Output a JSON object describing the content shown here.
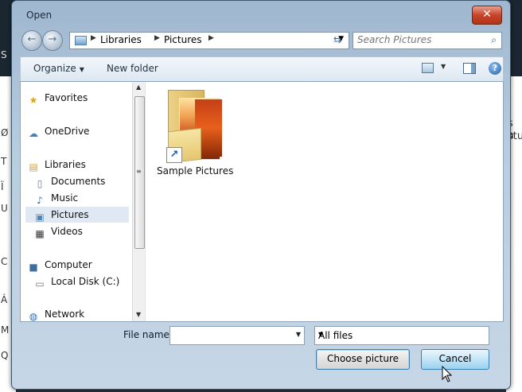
{
  "background": {
    "left_glyphs": [
      "S",
      "Ø",
      "T",
      "Ï",
      "U",
      "C",
      "Á",
      "M",
      "Q"
    ],
    "right_glyphs": [
      "s a",
      "stu"
    ]
  },
  "dialog": {
    "title": "Open",
    "close_label": "✕",
    "breadcrumb": [
      "Libraries",
      "Pictures"
    ],
    "search_placeholder": "Search Pictures",
    "toolbar": {
      "organize_label": "Organize",
      "new_folder_label": "New folder"
    },
    "nav_items": [
      {
        "label": "Favorites",
        "icon": "star-icon"
      },
      {
        "label": "OneDrive",
        "icon": "cloud-icon"
      },
      {
        "label": "Libraries",
        "icon": "library-icon"
      },
      {
        "label": "Documents",
        "icon": "document-icon"
      },
      {
        "label": "Music",
        "icon": "music-icon"
      },
      {
        "label": "Pictures",
        "icon": "pictures-icon",
        "selected": true
      },
      {
        "label": "Videos",
        "icon": "video-icon"
      },
      {
        "label": "Computer",
        "icon": "computer-icon"
      },
      {
        "label": "Local Disk (C:)",
        "icon": "disk-icon"
      },
      {
        "label": "Network",
        "icon": "network-icon"
      }
    ],
    "files": [
      {
        "name": "Sample Pictures",
        "type": "folder-shortcut"
      }
    ],
    "file_name_label": "File name:",
    "file_name_value": "",
    "file_type_value": "All files",
    "choose_button_label": "Choose picture",
    "cancel_button_label": "Cancel",
    "colors": {
      "accent": "#3c7fb1",
      "close": "#c8442a",
      "selected_nav": "#dfe8f3"
    }
  }
}
